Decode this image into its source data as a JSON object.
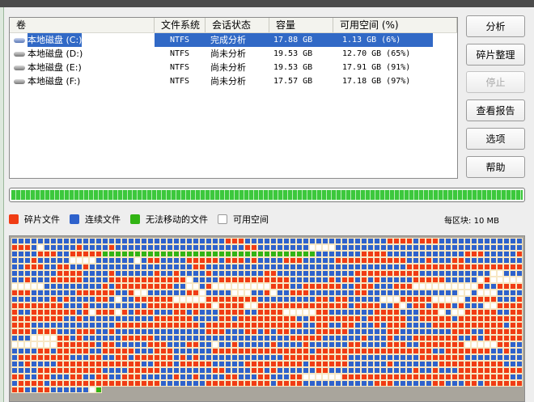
{
  "list": {
    "columns": [
      "卷",
      "文件系统",
      "会话状态",
      "容量",
      "可用空间 (%)"
    ],
    "rows": [
      {
        "volume": "本地磁盘 (C:)",
        "fs": "NTFS",
        "status": "完成分析",
        "capacity": "17.88 GB",
        "free": "1.13 GB (6%)",
        "selected": true
      },
      {
        "volume": "本地磁盘 (D:)",
        "fs": "NTFS",
        "status": "尚未分析",
        "capacity": "19.53 GB",
        "free": "12.70 GB (65%)"
      },
      {
        "volume": "本地磁盘 (E:)",
        "fs": "NTFS",
        "status": "尚未分析",
        "capacity": "19.53 GB",
        "free": "17.91 GB (91%)"
      },
      {
        "volume": "本地磁盘 (F:)",
        "fs": "NTFS",
        "status": "尚未分析",
        "capacity": "17.57 GB",
        "free": "17.18 GB (97%)"
      }
    ]
  },
  "buttons": {
    "analyze": "分析",
    "defrag": "碎片整理",
    "stop": "停止",
    "report": "查看报告",
    "options": "选项",
    "help": "帮助"
  },
  "progress_percent": 100,
  "legend": {
    "fragmented": {
      "label": "碎片文件",
      "color": "#f03c14"
    },
    "contiguous": {
      "label": "连续文件",
      "color": "#2e62cc"
    },
    "unmovable": {
      "label": "无法移动的文件",
      "color": "#32b414"
    },
    "free": {
      "label": "可用空间",
      "color": "#ffffff"
    },
    "block_size": "每区块: 10 MB"
  }
}
